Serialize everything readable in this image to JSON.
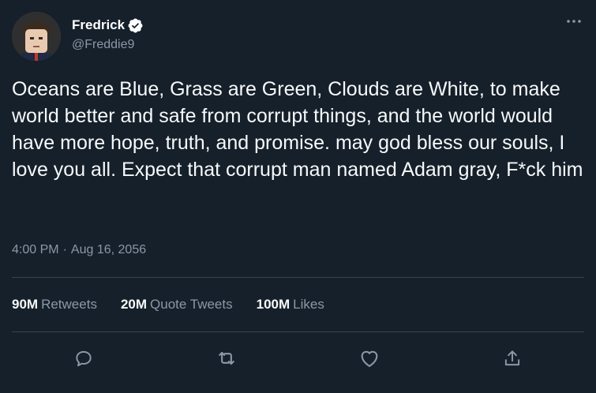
{
  "author": {
    "display_name": "Fredrick",
    "handle": "@Freddie9",
    "verified_icon": "verified-badge-icon",
    "avatar_icon": "avatar-image"
  },
  "tweet": {
    "text": "Oceans are Blue, Grass are Green, Clouds are White, to make world better and safe from corrupt things, and the world would have more hope, truth, and promise. may god bless our souls, I love you all. Expect that corrupt man named Adam gray, F*ck him",
    "time": "4:00 PM",
    "separator": "·",
    "date": "Aug 16, 2056"
  },
  "stats": {
    "retweets_count": "90M",
    "retweets_label": "Retweets",
    "quotes_count": "20M",
    "quotes_label": "Quote Tweets",
    "likes_count": "100M",
    "likes_label": "Likes"
  },
  "actions": {
    "reply_icon": "reply-icon",
    "retweet_icon": "retweet-icon",
    "like_icon": "like-icon",
    "share_icon": "share-icon",
    "more_icon": "more-options-icon"
  },
  "colors": {
    "background": "#15202b",
    "primary_text": "#f7f9f9",
    "secondary_text": "#8b98a5",
    "divider": "#38444d"
  }
}
